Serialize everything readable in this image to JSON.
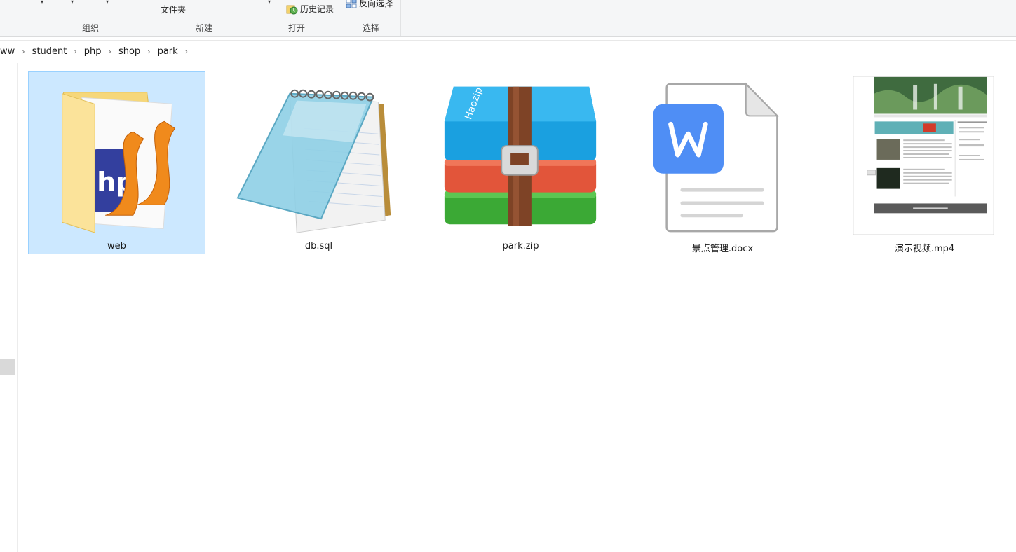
{
  "ribbon": {
    "groups": {
      "organize": "组织",
      "new": "新建",
      "open": "打开",
      "select": "选择"
    },
    "new_folder_label": "文件夹",
    "history_label": "历史记录",
    "invert_selection_label": "反向选择"
  },
  "breadcrumb": {
    "items": [
      "ww",
      "student",
      "php",
      "shop",
      "park"
    ]
  },
  "files": [
    {
      "name": "web",
      "icon": "php-folder-icon",
      "selected": true
    },
    {
      "name": "db.sql",
      "icon": "notepad-icon",
      "selected": false
    },
    {
      "name": "park.zip",
      "icon": "haozip-archive-icon",
      "selected": false
    },
    {
      "name": "景点管理.docx",
      "icon": "wps-document-icon",
      "selected": false
    },
    {
      "name": "演示视频.mp4",
      "icon": "video-thumbnail",
      "selected": false
    }
  ],
  "archive_brand": "Haozip",
  "colors": {
    "selection_bg": "#cce8ff",
    "selection_border": "#99d1ff",
    "wps_blue": "#4f8ef5"
  }
}
